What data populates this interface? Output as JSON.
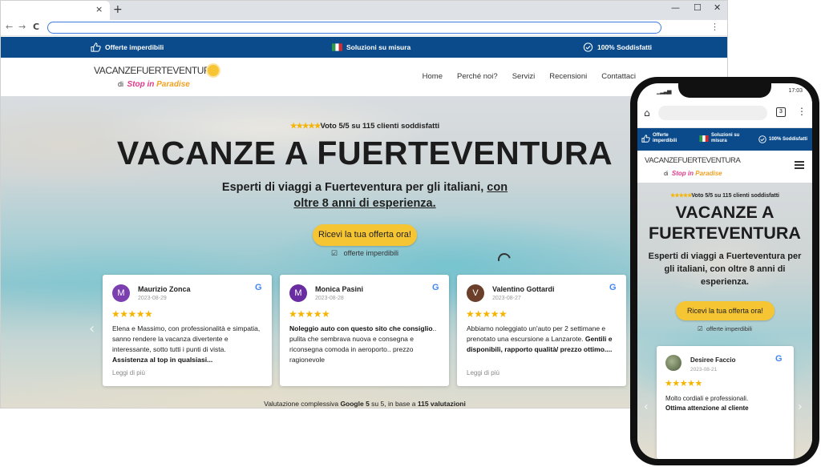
{
  "browser": {
    "tab_close": "×",
    "new_tab": "+",
    "win_min": "—",
    "win_max": "☐",
    "win_close": "✕",
    "back": "←",
    "forward": "→",
    "reload": "C",
    "menu": "⋮"
  },
  "topstrip": {
    "items": [
      {
        "label": "Offerte imperdibili",
        "icon": "thumbs-up-icon"
      },
      {
        "label": "Soluzioni su misura",
        "icon": "italy-flag-icon"
      },
      {
        "label": "100% Soddisfatti",
        "icon": "check-circle-icon"
      }
    ]
  },
  "logo": {
    "main": "VACANZEFUERTEVENTURA",
    "sub": "di",
    "brand_a": "Stop in ",
    "brand_b": "Paradise"
  },
  "menu": [
    "Home",
    "Perché noi?",
    "Servizi",
    "Recensioni",
    "Contattaci"
  ],
  "hero": {
    "stars": "★★★★★",
    "rating": "Voto 5/5 su 115 clienti soddisfatti",
    "title": "VACANZE A FUERTEVENTURA",
    "subtitle_a": "Esperti di viaggi a Fuerteventura per gli italiani, ",
    "subtitle_b": "con oltre 8 anni di esperienza.",
    "cta": "Ricevi la tua offerta ora!",
    "cta_note_icon": "☑",
    "cta_note": "offerte imperdibili"
  },
  "reviews": [
    {
      "initial": "M",
      "avatar_color": "#7b3fb0",
      "name": "Maurizio Zonca",
      "date": "2023-08-29",
      "stars": "★★★★★",
      "text_a": "Elena e Massimo, con professionalità e simpatia, sanno rendere la vacanza divertente e interessante, sotto tutti i punti di vista. ",
      "text_b": "Assistenza al top in qualsiasi...",
      "more": "Leggi di più"
    },
    {
      "initial": "M",
      "avatar_color": "#6a2da1",
      "name": "Monica Pasini",
      "date": "2023-08-28",
      "stars": "★★★★★",
      "text_a": "Noleggio auto con questo sito che consiglio",
      "text_b": ".. pulita che sembrava nuova e consegna e riconsegna comoda in aeroporto.. prezzo ragionevole",
      "more": ""
    },
    {
      "initial": "V",
      "avatar_color": "#6b3f2a",
      "name": "Valentino Gottardi",
      "date": "2023-08-27",
      "stars": "★★★★★",
      "text_a": "Abbiamo noleggiato un'auto per 2 settimane e prenotato una escursione a Lanzarote. ",
      "text_b": "Gentili e disponibili, rapporto qualità/ prezzo ottimo....",
      "more": "Leggi di più"
    }
  ],
  "google_icon": "G",
  "arrows": {
    "prev": "‹",
    "next": "›"
  },
  "overall": {
    "a": "Valutazione complessiva ",
    "b": "Google 5",
    "c": " su 5, in base a ",
    "d": "115 valutazioni"
  },
  "phone": {
    "time": "17:03",
    "signal": "▁▂▃▅",
    "tab_count": "3",
    "home": "⌂",
    "menu": "⋮",
    "strip": [
      {
        "label_a": "Offerte",
        "label_b": "imperdibili"
      },
      {
        "label_a": "Soluzioni su",
        "label_b": "misura"
      },
      {
        "label_a": "100% Soddisfatti",
        "label_b": ""
      }
    ],
    "rating": "Voto 5/5 su 115 clienti soddisfatti",
    "title": "VACANZE A FUERTEVENTURA",
    "subtitle": "Esperti di viaggi a Fuerteventura per gli italiani, con oltre 8 anni di esperienza.",
    "cta": "Ricevi la tua offerta ora!",
    "cta_note": "offerte imperdibili",
    "review": {
      "name": "Desiree Faccio",
      "date": "2023-08-21",
      "stars": "★★★★★",
      "text_a": "Molto cordiali e professionali.",
      "text_b": "Ottima attenzione al cliente"
    }
  }
}
